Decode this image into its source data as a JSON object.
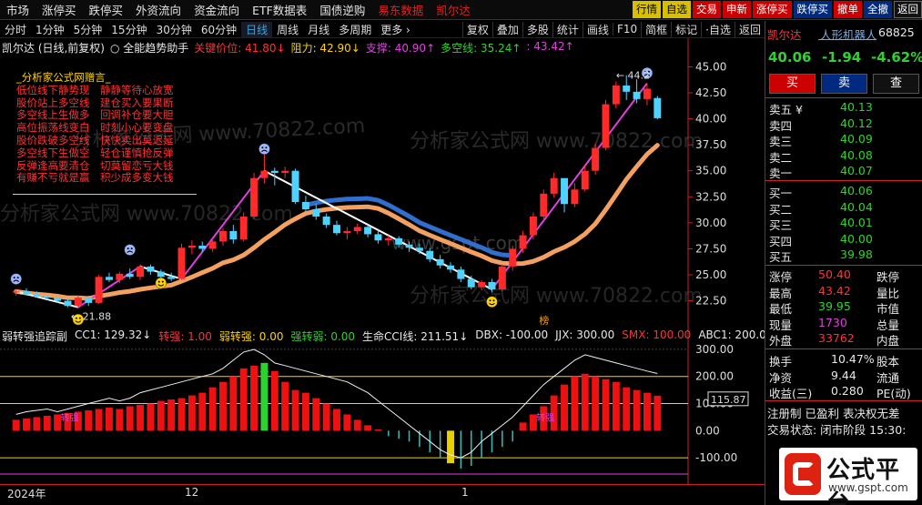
{
  "menu": {
    "items": [
      "市场",
      "涨停买",
      "跌停买",
      "外资流向",
      "资金流向",
      "ETF数据表",
      "国债逆购"
    ],
    "red_items": [
      "易东数据",
      "凯尔达"
    ],
    "buttons": [
      {
        "label": "行情",
        "style": "yel"
      },
      {
        "label": "自选",
        "style": "yel"
      },
      {
        "label": "交易",
        "style": "red"
      },
      {
        "label": "申新",
        "style": "red"
      },
      {
        "label": "涨停买",
        "style": "red"
      },
      {
        "label": "跌停买",
        "style": "bl"
      },
      {
        "label": "撤单",
        "style": "red"
      },
      {
        "label": "全撤",
        "style": "bl"
      },
      {
        "label": "返回",
        "style": "bk"
      }
    ]
  },
  "toolbar": {
    "periods": [
      "分时",
      "1分钟",
      "5分钟",
      "15分钟",
      "30分钟",
      "60分钟",
      "日线",
      "周线",
      "月线",
      "多周期",
      "更多 ›"
    ],
    "active": "日线",
    "right": [
      "复权",
      "叠加",
      "多股",
      "统计",
      "画线",
      "F10",
      "简框",
      "标记",
      "·自选",
      "返回"
    ]
  },
  "main_legend": [
    {
      "text": "凯尔达 (日线,前复权)",
      "color": "#e8e8e8"
    },
    {
      "text": "○ 全能趋势助手",
      "color": "#e8e8e8"
    },
    {
      "text": "关键价位: 41.80↓",
      "color": "#ff3232"
    },
    {
      "text": "阻力: 42.90↓",
      "color": "#ffd200"
    },
    {
      "text": "支撑: 40.90↑",
      "color": "#e040e0"
    },
    {
      "text": "多空线: 35.24↑",
      "color": "#2dd32d"
    },
    {
      "text": ": 43.42↑",
      "color": "#e040e0"
    }
  ],
  "note_box": {
    "title": "_分析家公式网赠言_",
    "lines": [
      "低位线下静势现　静静等待心放宽",
      "股价站上多空线　建仓买入要果断",
      "多空线上生做多　回调补仓要大胆",
      "高位振荡线变白　时刻小心要变盘",
      "股价跌破多空线　快快卖出莫迟延",
      "多空线下生做空　轻仓谨慎抢反弹",
      "反弹逢高要清仓　切莫留恋亏大钱",
      "有赚不亏就是赢　积少成多变大钱"
    ]
  },
  "main_axis": [
    "45.00",
    "42.50",
    "40.00",
    "37.50",
    "35.00",
    "32.50",
    "30.00",
    "27.50",
    "25.00",
    "22.50"
  ],
  "annotations": {
    "low": "← 21.88",
    "high": "← 44.2",
    "marker": "榜"
  },
  "watermarks": [
    "分析家公式网 www.70822.com",
    "www.gspt.com"
  ],
  "sub_legend": [
    {
      "text": "弱转强追踪副",
      "color": "#e8e8e8"
    },
    {
      "text": "CC1: 129.32↓",
      "color": "#e8e8e8"
    },
    {
      "text": "转强: 1.00",
      "color": "#ff3232"
    },
    {
      "text": "弱转强: 0.00",
      "color": "#ffd200"
    },
    {
      "text": "强转弱: 0.00",
      "color": "#2dd32d"
    },
    {
      "text": "生命CCI线: 211.51↓",
      "color": "#e8e8e8"
    },
    {
      "text": "DBX: -100.00",
      "color": "#e8e8e8"
    },
    {
      "text": "JJX: 300.00",
      "color": "#e8e8e8"
    },
    {
      "text": "SMX: 100.00",
      "color": "#ff3232"
    },
    {
      "text": "ABC1: 200.0",
      "color": "#e8e8e8"
    }
  ],
  "sub_axis": [
    "300.00",
    "200.00",
    "100.00",
    "0.00",
    "-100.00"
  ],
  "sub_axis_tag": "115.87",
  "sub_marker_label": "转强",
  "date_axis": {
    "labels": [
      "2024年",
      "12",
      "1"
    ]
  },
  "stock": {
    "name": "凯尔达",
    "tag": "人形机器人",
    "code": "68825",
    "price": "40.06",
    "change": "-1.94",
    "pct": "-4.62%",
    "actions": [
      "买",
      "卖",
      "查"
    ],
    "sells": [
      {
        "l": "卖五 ¥",
        "p": "40.13"
      },
      {
        "l": "卖四",
        "p": "40.12"
      },
      {
        "l": "卖三",
        "p": "40.09"
      },
      {
        "l": "卖二",
        "p": "40.08"
      },
      {
        "l": "卖一",
        "p": "40.07"
      }
    ],
    "buys": [
      {
        "l": "买一",
        "p": "40.06"
      },
      {
        "l": "买二",
        "p": "40.04"
      },
      {
        "l": "买三",
        "p": "40.01"
      },
      {
        "l": "买四",
        "p": "40.00"
      },
      {
        "l": "买五",
        "p": "39.98"
      }
    ],
    "stats": [
      {
        "l": "涨停",
        "v": "50.40",
        "vc": "r",
        "l2": "跌停"
      },
      {
        "l": "最高",
        "v": "43.42",
        "vc": "r",
        "l2": "量比"
      },
      {
        "l": "最低",
        "v": "39.95",
        "vc": "g",
        "l2": "市值"
      },
      {
        "l": "现量",
        "v": "1730",
        "vc": "m",
        "l2": "总量"
      },
      {
        "l": "外盘",
        "v": "33762",
        "vc": "r",
        "l2": "内盘"
      }
    ],
    "stats2": [
      {
        "l": "换手",
        "v": "10.47%",
        "l2": "股本"
      },
      {
        "l": "净资",
        "v": "9.44",
        "l2": "流通"
      },
      {
        "l": "收益(三)",
        "v": "0.280",
        "l2": "PE(动)"
      }
    ],
    "notes": [
      "注册制 已盈利 表决权无差",
      "交易状态: 闭市阶段 15:30:"
    ]
  },
  "logo": {
    "title": "公式平台",
    "url": "www.gspt.com"
  },
  "chart_data": {
    "type": "candlestick",
    "ylim": [
      21.5,
      46.0
    ],
    "candles": [
      [
        23.3,
        23.6,
        23.0,
        23.4
      ],
      [
        23.4,
        23.7,
        23.0,
        23.1
      ],
      [
        23.1,
        23.4,
        22.8,
        22.9
      ],
      [
        22.9,
        23.2,
        22.6,
        22.8
      ],
      [
        22.8,
        23.0,
        22.3,
        22.5
      ],
      [
        22.5,
        22.7,
        21.88,
        22.0
      ],
      [
        22.0,
        23.0,
        21.9,
        22.8
      ],
      [
        22.8,
        23.0,
        22.0,
        22.3
      ],
      [
        22.3,
        25.0,
        22.2,
        24.8
      ],
      [
        24.8,
        25.2,
        24.3,
        24.5
      ],
      [
        24.5,
        25.3,
        24.2,
        25.1
      ],
      [
        25.1,
        25.6,
        24.6,
        24.8
      ],
      [
        24.8,
        26.0,
        24.5,
        25.8
      ],
      [
        25.8,
        26.0,
        25.0,
        25.3
      ],
      [
        25.3,
        25.5,
        24.5,
        24.8
      ],
      [
        24.8,
        25.2,
        24.4,
        24.6
      ],
      [
        24.6,
        28.0,
        24.5,
        27.6
      ],
      [
        27.6,
        28.3,
        27.0,
        27.8
      ],
      [
        27.8,
        28.2,
        27.2,
        27.5
      ],
      [
        27.5,
        28.5,
        27.2,
        28.2
      ],
      [
        28.2,
        29.5,
        27.8,
        29.2
      ],
      [
        29.2,
        29.8,
        28.0,
        28.4
      ],
      [
        28.4,
        31.0,
        28.2,
        30.6
      ],
      [
        30.6,
        34.8,
        30.4,
        34.3
      ],
      [
        34.3,
        37.5,
        33.8,
        35.0
      ],
      [
        35.0,
        35.3,
        33.6,
        34.8
      ],
      [
        34.8,
        35.4,
        34.3,
        35.0
      ],
      [
        35.0,
        35.2,
        31.8,
        32.0
      ],
      [
        32.0,
        32.6,
        31.0,
        31.3
      ],
      [
        31.3,
        31.8,
        30.3,
        30.6
      ],
      [
        30.6,
        30.9,
        29.5,
        29.8
      ],
      [
        29.8,
        30.2,
        28.8,
        29.0
      ],
      [
        29.0,
        29.6,
        28.4,
        29.2
      ],
      [
        29.2,
        29.9,
        28.9,
        29.6
      ],
      [
        29.6,
        29.8,
        28.6,
        28.9
      ],
      [
        28.9,
        29.3,
        28.0,
        28.3
      ],
      [
        28.3,
        28.8,
        27.8,
        28.5
      ],
      [
        28.5,
        28.7,
        27.6,
        27.9
      ],
      [
        27.9,
        28.2,
        27.2,
        27.6
      ],
      [
        27.6,
        28.0,
        27.0,
        27.3
      ],
      [
        27.3,
        27.6,
        26.2,
        26.5
      ],
      [
        26.5,
        26.9,
        25.6,
        25.9
      ],
      [
        25.9,
        26.2,
        25.2,
        25.5
      ],
      [
        25.5,
        25.8,
        24.3,
        24.6
      ],
      [
        24.6,
        24.9,
        23.6,
        23.8
      ],
      [
        23.8,
        24.5,
        23.5,
        24.3
      ],
      [
        24.3,
        24.6,
        23.3,
        23.6
      ],
      [
        23.6,
        26.0,
        23.4,
        25.8
      ],
      [
        25.8,
        27.8,
        25.4,
        27.5
      ],
      [
        27.5,
        29.2,
        27.1,
        28.8
      ],
      [
        28.8,
        31.0,
        28.4,
        30.6
      ],
      [
        30.6,
        33.2,
        30.2,
        32.8
      ],
      [
        32.8,
        34.8,
        32.4,
        34.3
      ],
      [
        34.3,
        33.5,
        31.0,
        31.8
      ],
      [
        31.8,
        33.8,
        31.5,
        33.2
      ],
      [
        33.2,
        35.5,
        33.0,
        35.0
      ],
      [
        35.0,
        37.6,
        34.6,
        37.2
      ],
      [
        37.2,
        41.8,
        37.0,
        41.4
      ],
      [
        41.4,
        43.6,
        41.0,
        43.2
      ],
      [
        43.2,
        44.2,
        41.8,
        42.6
      ],
      [
        42.6,
        43.8,
        41.5,
        41.9
      ],
      [
        41.9,
        43.42,
        41.3,
        42.9
      ],
      [
        42.0,
        42.2,
        39.95,
        40.06
      ]
    ],
    "sub": {
      "ylim": [
        -150,
        320
      ],
      "bars": [
        40,
        45,
        50,
        55,
        60,
        65,
        70,
        75,
        80,
        85,
        80,
        90,
        95,
        100,
        110,
        115,
        120,
        130,
        140,
        160,
        180,
        200,
        230,
        240,
        250,
        220,
        180,
        150,
        140,
        120,
        100,
        80,
        60,
        40,
        20,
        5,
        -20,
        -30,
        -40,
        -60,
        -80,
        -100,
        -120,
        -140,
        -130,
        -100,
        -80,
        -60,
        -40,
        30,
        60,
        90,
        130,
        170,
        200,
        210,
        200,
        190,
        180,
        160,
        150,
        140,
        129
      ],
      "cci": [
        60,
        70,
        75,
        80,
        70,
        80,
        90,
        100,
        110,
        120,
        110,
        120,
        140,
        150,
        160,
        170,
        180,
        190,
        200,
        210,
        230,
        260,
        290,
        300,
        280,
        250,
        240,
        230,
        220,
        210,
        200,
        190,
        180,
        160,
        140,
        110,
        80,
        50,
        20,
        -10,
        -40,
        -70,
        -90,
        -100,
        -80,
        -40,
        -10,
        20,
        50,
        90,
        130,
        170,
        200,
        230,
        260,
        280,
        270,
        260,
        250,
        240,
        230,
        220,
        211
      ]
    }
  }
}
